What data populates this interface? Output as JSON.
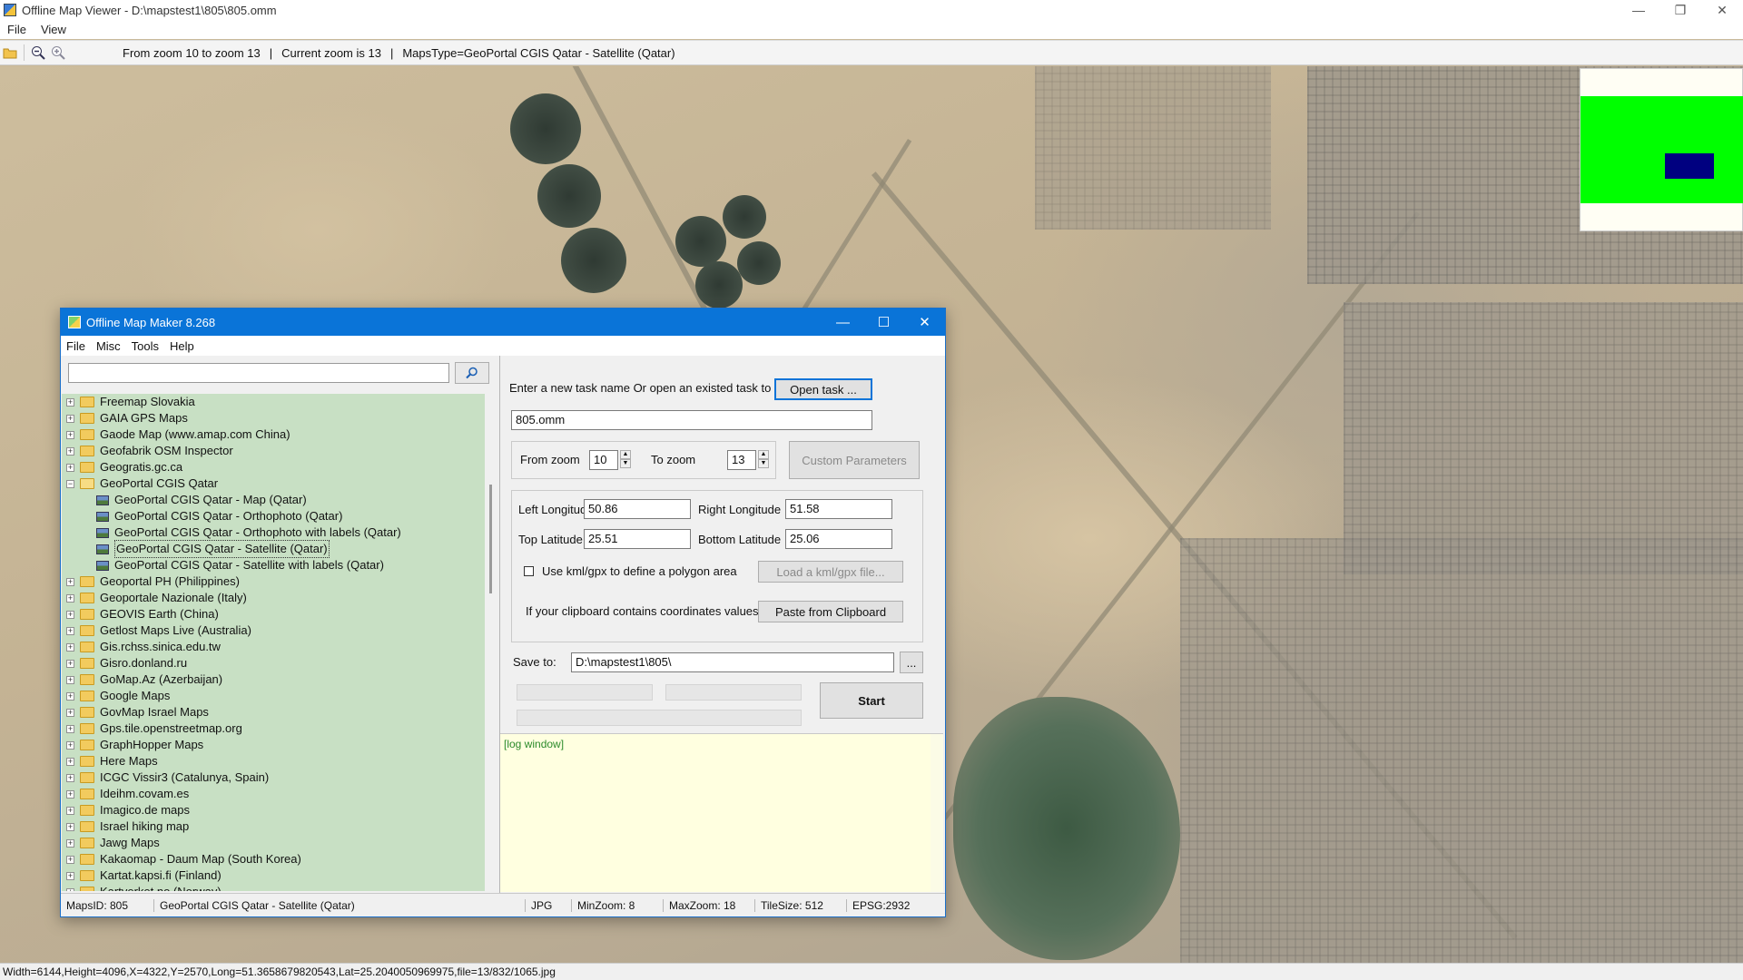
{
  "app": {
    "title": "Offline Map Viewer - D:\\mapstest1\\805\\805.omm",
    "menu": [
      "File",
      "View"
    ],
    "window_controls": [
      "—",
      "❐",
      "✕"
    ]
  },
  "toolbar": {
    "zoom_range": "From zoom 10 to zoom 13",
    "sep1": "|",
    "current_zoom": "Current zoom is 13",
    "sep2": "|",
    "maps_type": "MapsType=GeoPortal CGIS Qatar - Satellite (Qatar)"
  },
  "statusbar": {
    "text": "Width=6144,Height=4096,X=4322,Y=2570,Long=51.3658679820543,Lat=25.2040050969975,file=13/832/1065.jpg"
  },
  "dialog": {
    "title": "Offline Map Maker 8.268",
    "menu": [
      "File",
      "Misc",
      "Tools",
      "Help"
    ],
    "window_controls": [
      "—",
      "☐",
      "✕"
    ],
    "search": {
      "value": "",
      "icon": "magnifier-icon"
    },
    "tree": [
      {
        "label": "Freemap Slovakia",
        "expanded": false
      },
      {
        "label": "GAIA GPS Maps",
        "expanded": false
      },
      {
        "label": "Gaode Map (www.amap.com China)",
        "expanded": false
      },
      {
        "label": "Geofabrik OSM Inspector",
        "expanded": false
      },
      {
        "label": "Geogratis.gc.ca",
        "expanded": false
      },
      {
        "label": "GeoPortal CGIS Qatar",
        "expanded": true
      },
      {
        "label": "GeoPortal CGIS Qatar - Map (Qatar)",
        "child": true
      },
      {
        "label": "GeoPortal CGIS Qatar - Orthophoto (Qatar)",
        "child": true
      },
      {
        "label": "GeoPortal CGIS Qatar - Orthophoto with labels (Qatar)",
        "child": true
      },
      {
        "label": "GeoPortal CGIS Qatar - Satellite (Qatar)",
        "child": true,
        "selected": true
      },
      {
        "label": "GeoPortal CGIS Qatar - Satellite with labels (Qatar)",
        "child": true
      },
      {
        "label": "Geoportal PH (Philippines)",
        "expanded": false
      },
      {
        "label": "Geoportale Nazionale (Italy)",
        "expanded": false
      },
      {
        "label": "GEOVIS Earth (China)",
        "expanded": false
      },
      {
        "label": "Getlost Maps Live (Australia)",
        "expanded": false
      },
      {
        "label": "Gis.rchss.sinica.edu.tw",
        "expanded": false
      },
      {
        "label": "Gisro.donland.ru",
        "expanded": false
      },
      {
        "label": "GoMap.Az (Azerbaijan)",
        "expanded": false
      },
      {
        "label": "Google Maps",
        "expanded": false
      },
      {
        "label": "GovMap Israel Maps",
        "expanded": false
      },
      {
        "label": "Gps.tile.openstreetmap.org",
        "expanded": false
      },
      {
        "label": "GraphHopper Maps",
        "expanded": false
      },
      {
        "label": "Here Maps",
        "expanded": false
      },
      {
        "label": "ICGC Vissir3 (Catalunya, Spain)",
        "expanded": false
      },
      {
        "label": "Ideihm.covam.es",
        "expanded": false
      },
      {
        "label": "Imagico.de maps",
        "expanded": false
      },
      {
        "label": "Israel hiking map",
        "expanded": false
      },
      {
        "label": "Jawg Maps",
        "expanded": false
      },
      {
        "label": "Kakaomap - Daum Map (South Korea)",
        "expanded": false
      },
      {
        "label": "Kartat.kapsi.fi (Finland)",
        "expanded": false
      },
      {
        "label": "Kartverket.no (Norway)",
        "expanded": false
      }
    ],
    "task": {
      "prompt": "Enter a new task name Or open an existed task to continue:",
      "open_button": "Open task ...",
      "name_value": "805.omm"
    },
    "zoom": {
      "from_label": "From zoom",
      "from_value": "10",
      "to_label": "To zoom",
      "to_value": "13",
      "custom_button": "Custom Parameters"
    },
    "coords": {
      "left_lon_label": "Left Longitude",
      "left_lon_value": "50.86",
      "right_lon_label": "Right Longitude",
      "right_lon_value": "51.58",
      "top_lat_label": "Top Latitude",
      "top_lat_value": "25.51",
      "bottom_lat_label": "Bottom Latitude",
      "bottom_lat_value": "25.06",
      "kml_checkbox_label": "Use kml/gpx to define a polygon area",
      "kml_button": "Load a kml/gpx file...",
      "clipboard_label": "If your clipboard contains coordinates values:",
      "clipboard_button": "Paste from Clipboard"
    },
    "save": {
      "label": "Save to:",
      "value": "D:\\mapstest1\\805\\",
      "browse_button": "...",
      "start_button": "Start"
    },
    "log": {
      "text": "[log window]"
    },
    "status": {
      "maps_id": "MapsID: 805",
      "maps_name": "GeoPortal CGIS Qatar - Satellite (Qatar)",
      "format": "JPG",
      "min_zoom": "MinZoom: 8",
      "max_zoom": "MaxZoom: 18",
      "tile_size": "TileSize: 512",
      "epsg": "EPSG:2932"
    }
  },
  "colors": {
    "dialog_title": "#0a74d8",
    "tree_bg": "#c8e0c4",
    "log_bg": "#ffffe0",
    "minimap_green": "#00ff00",
    "minimap_blue": "#000080"
  }
}
